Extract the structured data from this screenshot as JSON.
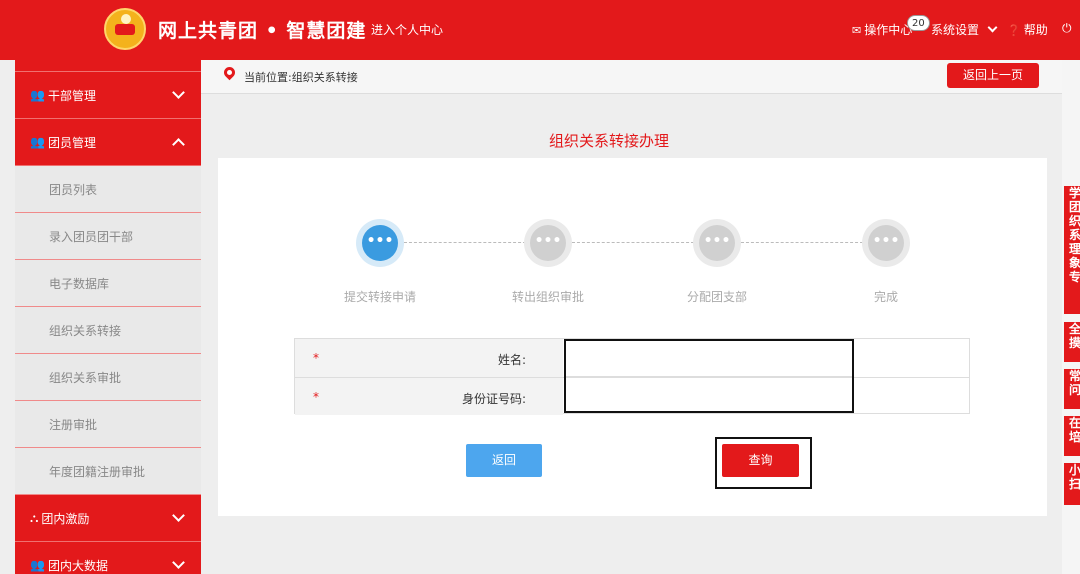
{
  "header": {
    "title": "网上共青团 • 智慧团建",
    "enter_center": "进入个人中心",
    "ops_center": "操作中心",
    "ops_badge": "20",
    "settings": "系统设置",
    "help": "帮助"
  },
  "sidebar": {
    "items": [
      {
        "label": "干部管理",
        "type": "group",
        "expanded": false
      },
      {
        "label": "团员管理",
        "type": "group",
        "expanded": true
      },
      {
        "label": "团员列表",
        "type": "sub"
      },
      {
        "label": "录入团员团干部",
        "type": "sub"
      },
      {
        "label": "电子数据库",
        "type": "sub"
      },
      {
        "label": "组织关系转接",
        "type": "sub"
      },
      {
        "label": "组织关系审批",
        "type": "sub"
      },
      {
        "label": "注册审批",
        "type": "sub"
      },
      {
        "label": "年度团籍注册审批",
        "type": "sub"
      },
      {
        "label": "团内激励",
        "type": "group",
        "expanded": false
      },
      {
        "label": "团内大数据",
        "type": "group",
        "expanded": false
      }
    ]
  },
  "right_tabs": [
    "学团织系理象专",
    "全摸",
    "常问",
    "在培",
    "小扫"
  ],
  "breadcrumb": {
    "text": "当前位置:组织关系转接"
  },
  "back_top": "返回上一页",
  "main": {
    "title": "组织关系转接办理",
    "steps": [
      {
        "label": "提交转接申请",
        "active": true
      },
      {
        "label": "转出组织审批",
        "active": false
      },
      {
        "label": "分配团支部",
        "active": false
      },
      {
        "label": "完成",
        "active": false
      }
    ],
    "form": {
      "required_mark": "*",
      "name_label": "姓名:",
      "id_label": "身份证号码:",
      "name_value": "",
      "id_value": ""
    },
    "back_button": "返回",
    "query_button": "查询"
  },
  "colors": {
    "brand": "#e3191b",
    "step_active": "#3a9be0",
    "back_button": "#4da6ee"
  }
}
